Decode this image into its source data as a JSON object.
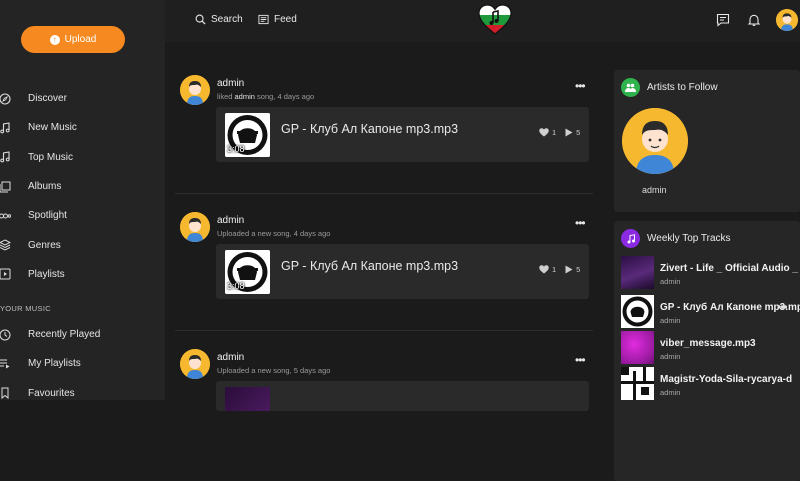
{
  "sidebar": {
    "upload_label": "Upload",
    "nav": [
      {
        "label": "Discover",
        "icon": "compass-icon"
      },
      {
        "label": "New Music",
        "icon": "music-note-icon"
      },
      {
        "label": "Top Music",
        "icon": "music-note-icon"
      },
      {
        "label": "Albums",
        "icon": "albums-icon"
      },
      {
        "label": "Spotlight",
        "icon": "spotlight-icon"
      },
      {
        "label": "Genres",
        "icon": "layers-icon"
      },
      {
        "label": "Playlists",
        "icon": "playlist-icon"
      }
    ],
    "section_label": "YOUR MUSIC",
    "my_nav": [
      {
        "label": "Recently Played",
        "icon": "history-icon"
      },
      {
        "label": "My Playlists",
        "icon": "playlist-add-icon"
      },
      {
        "label": "Favourites",
        "icon": "bookmark-icon"
      }
    ]
  },
  "header": {
    "search_label": "Search",
    "feed_label": "Feed"
  },
  "feed": {
    "posts": [
      {
        "user": "admin",
        "meta_prefix": "liked ",
        "meta_bold": "admin",
        "meta_suffix": " song, 4 days ago",
        "song_title": "GP - Клуб Ал Капоне mp3.mp3",
        "duration": "3:08",
        "likes": "1",
        "plays": "5"
      },
      {
        "user": "admin",
        "meta_prefix": "Uploaded a new song, 4 days ago",
        "meta_bold": "",
        "meta_suffix": "",
        "song_title": "GP - Клуб Ал Капоне mp3.mp3",
        "duration": "3:08",
        "likes": "1",
        "plays": "5"
      },
      {
        "user": "admin",
        "meta_prefix": "Uploaded a new song, 5 days ago",
        "meta_bold": "",
        "meta_suffix": "",
        "song_title": "",
        "duration": "",
        "likes": "",
        "plays": ""
      }
    ]
  },
  "artists": {
    "title": "Artists to Follow",
    "items": [
      {
        "name": "admin"
      }
    ]
  },
  "top_tracks": {
    "title": "Weekly Top Tracks",
    "items": [
      {
        "title": "Zivert - Life _ Official Audio _",
        "artist": "admin"
      },
      {
        "title": "GP - Клуб Ал Капоне mp3.mp3",
        "artist": "admin"
      },
      {
        "title": "viber_message.mp3",
        "artist": "admin"
      },
      {
        "title": "Magistr-Yoda-Sila-rycarya-d",
        "artist": "admin"
      }
    ]
  },
  "colors": {
    "accent": "#f6891f",
    "artists_icon_bg": "#2fb34d",
    "tracks_icon_bg": "#8a2be2"
  }
}
